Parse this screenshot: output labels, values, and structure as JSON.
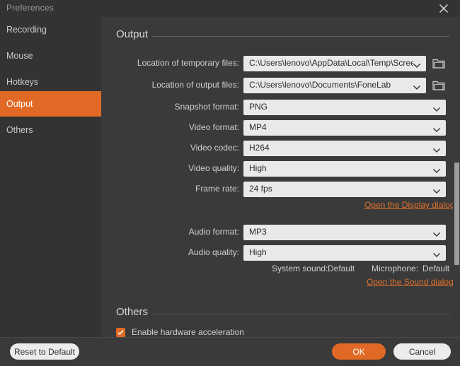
{
  "window": {
    "title": "Preferences",
    "close_icon": "close-icon"
  },
  "sidebar": {
    "items": [
      {
        "label": "Recording",
        "active": false
      },
      {
        "label": "Mouse",
        "active": false
      },
      {
        "label": "Hotkeys",
        "active": false
      },
      {
        "label": "Output",
        "active": true
      },
      {
        "label": "Others",
        "active": false
      }
    ]
  },
  "sections": {
    "output": {
      "title": "Output",
      "rows": [
        {
          "label": "Location of temporary files:",
          "value": "C:\\Users\\lenovo\\AppData\\Local\\Temp\\Screen",
          "folder": true
        },
        {
          "label": "Location of output files:",
          "value": "C:\\Users\\lenovo\\Documents\\FoneLab",
          "folder": true
        },
        {
          "label": "Snapshot format:",
          "value": "PNG",
          "folder": false
        },
        {
          "label": "Video format:",
          "value": "MP4",
          "folder": false
        },
        {
          "label": "Video codec:",
          "value": "H264",
          "folder": false
        },
        {
          "label": "Video quality:",
          "value": "High",
          "folder": false
        },
        {
          "label": "Frame rate:",
          "value": "24 fps",
          "folder": false
        }
      ],
      "display_link": "Open the Display dialog",
      "audio_rows": [
        {
          "label": "Audio format:",
          "value": "MP3"
        },
        {
          "label": "Audio quality:",
          "value": "High"
        }
      ],
      "system_sound_label": "System sound:",
      "system_sound_value": "Default",
      "microphone_label": "Microphone:",
      "microphone_value": "Default",
      "sound_link": "Open the Sound dialog"
    },
    "others": {
      "title": "Others",
      "checkbox_label": "Enable hardware acceleration",
      "checkbox_checked": true
    }
  },
  "footer": {
    "reset_label": "Reset to Default",
    "ok_label": "OK",
    "cancel_label": "Cancel"
  },
  "colors": {
    "accent": "#e06a25",
    "window_bg": "#3a3a3a",
    "sidebar_bg": "#333333",
    "dropdown_bg": "#e9e9e9",
    "link": "#e0702a"
  }
}
